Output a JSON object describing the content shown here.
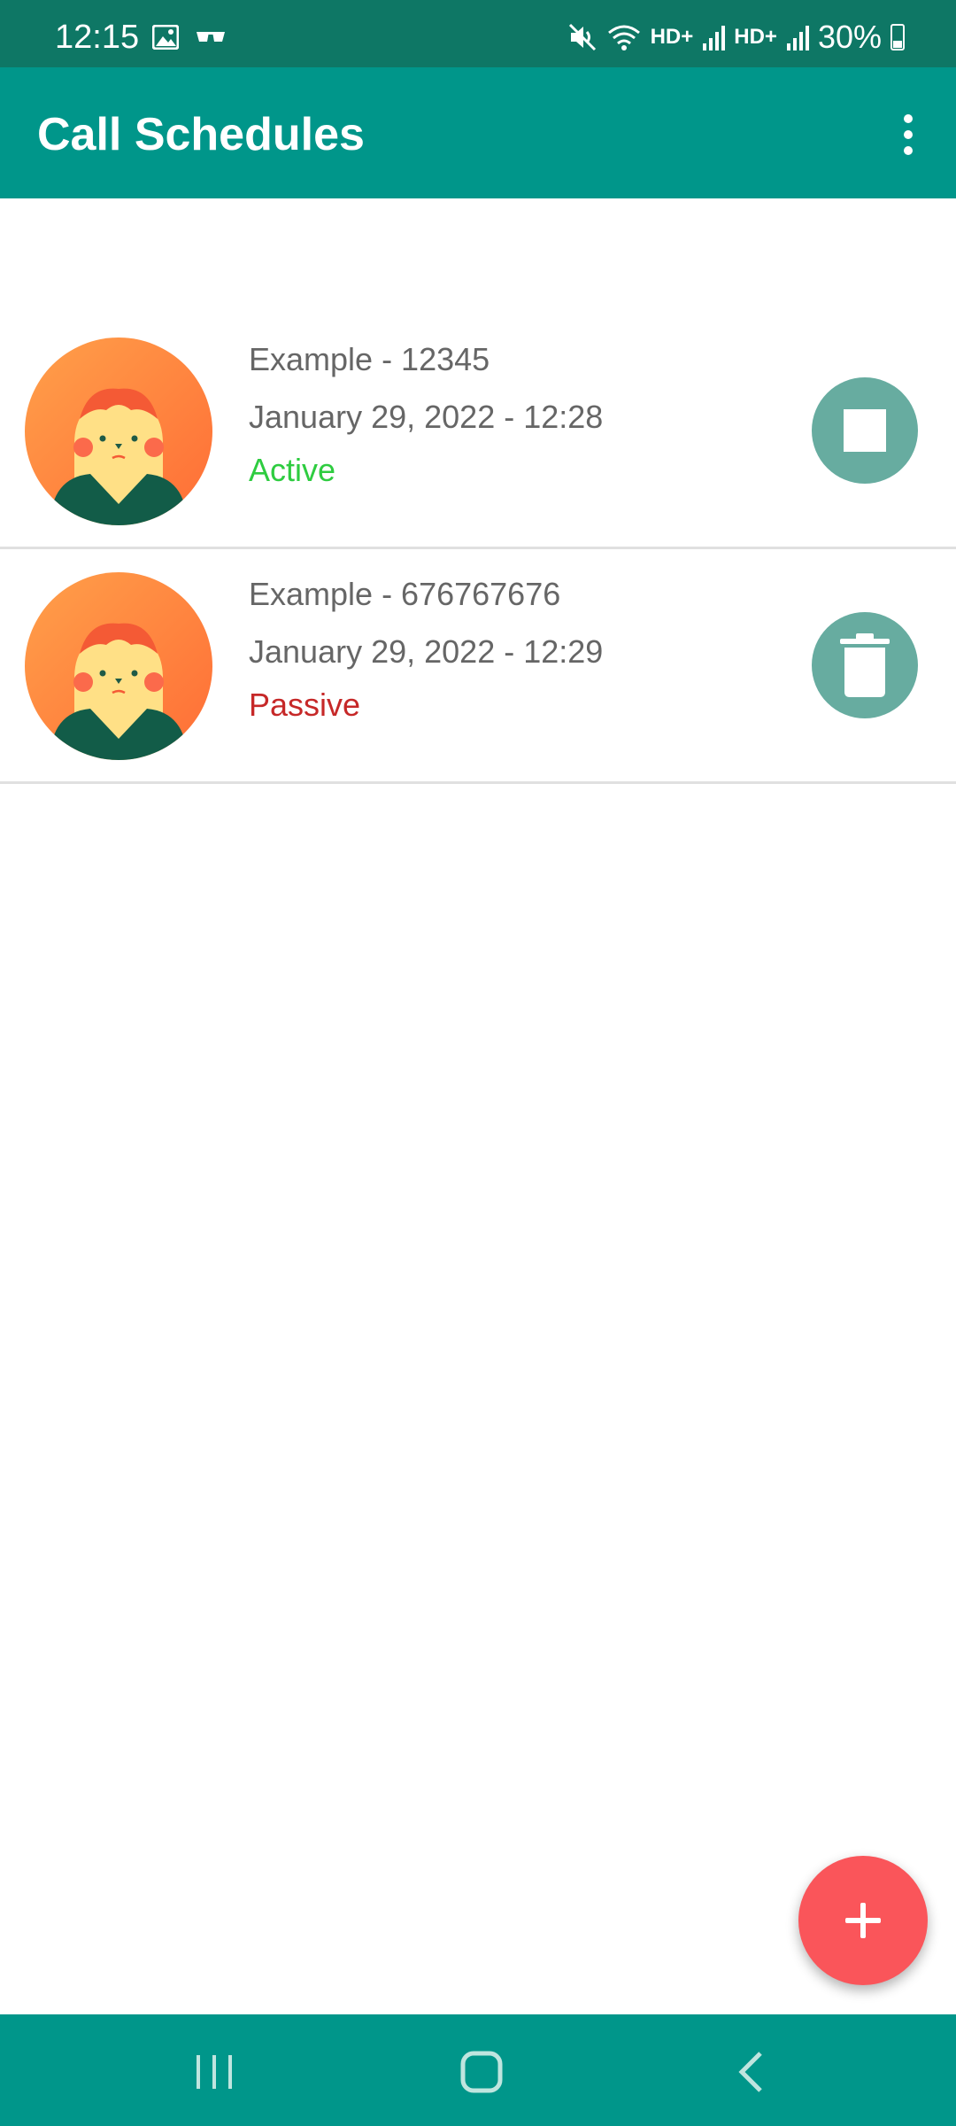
{
  "status_bar": {
    "time": "12:15",
    "hd1": "HD+",
    "hd2": "HD+",
    "battery": "30%"
  },
  "app_bar": {
    "title": "Call Schedules"
  },
  "schedules": [
    {
      "name": "Example - 12345",
      "datetime": "January 29, 2022 - 12:28",
      "status": "Active",
      "status_color": "#2ecc40",
      "action_icon": "stop-icon"
    },
    {
      "name": "Example - 676767676",
      "datetime": "January 29, 2022 - 12:29",
      "status": "Passive",
      "status_color": "#c62828",
      "action_icon": "trash-icon"
    }
  ],
  "fab": {
    "icon": "plus-icon",
    "color": "#fa555a"
  },
  "colors": {
    "status_bar": "#0e7765",
    "app_bar": "#00968a",
    "action_button": "#67aca0"
  }
}
